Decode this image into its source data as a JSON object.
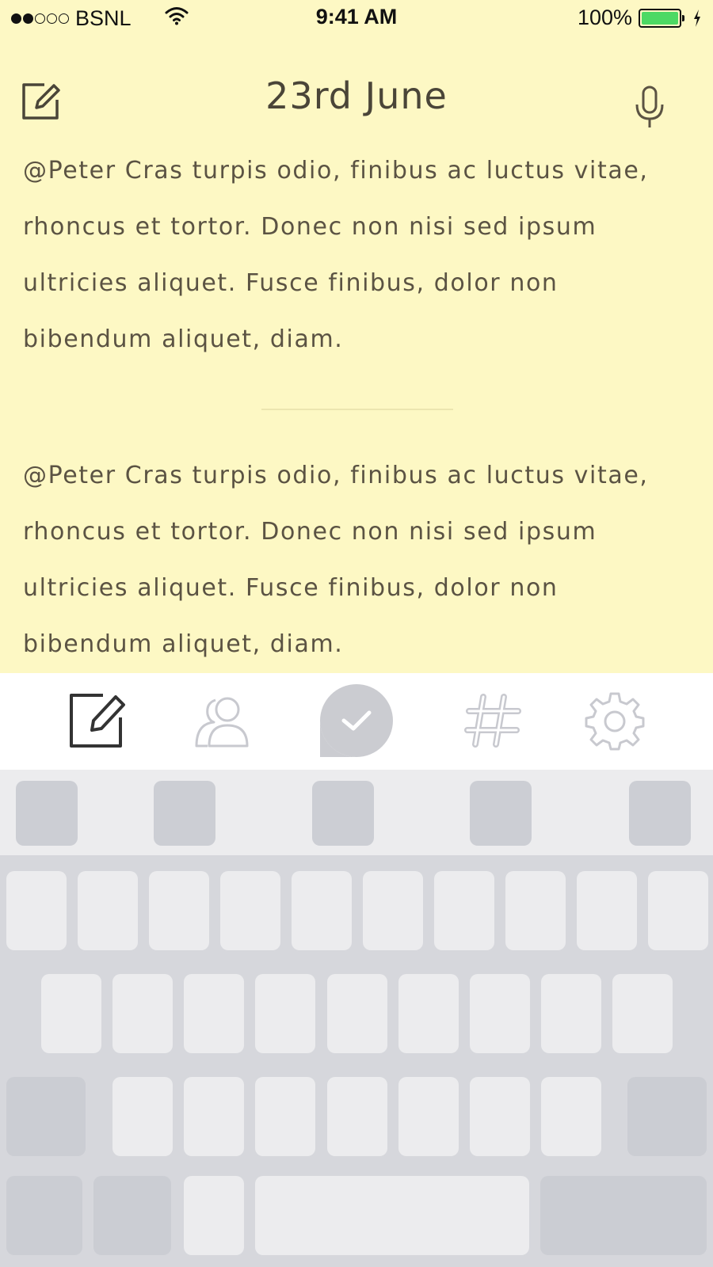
{
  "status_bar": {
    "carrier": "BSNL",
    "signal_filled": 2,
    "signal_total": 5,
    "time": "9:41 AM",
    "battery_percent": "100%",
    "battery_level": 1.0,
    "battery_color": "#4cd964"
  },
  "header": {
    "title": "23rd June",
    "left_icon": "compose-icon",
    "right_icon": "microphone-icon"
  },
  "notes": [
    {
      "text": "@Peter Cras turpis odio, finibus ac luctus vitae, rhoncus et tortor. Donec non nisi sed ipsum ultricies aliquet. Fusce finibus, dolor non bibendum aliquet, diam."
    },
    {
      "text": "@Peter Cras turpis odio, finibus ac luctus vitae, rhoncus et tortor. Donec non nisi sed ipsum ultricies aliquet. Fusce finibus, dolor non bibendum aliquet, diam."
    }
  ],
  "tabbar": {
    "tabs": [
      {
        "icon": "compose-icon",
        "active": true
      },
      {
        "icon": "contacts-icon",
        "active": false
      },
      {
        "icon": "checkmark-icon",
        "active": false
      },
      {
        "icon": "hashtag-icon",
        "active": false
      },
      {
        "icon": "settings-gear-icon",
        "active": false
      }
    ]
  },
  "colors": {
    "note_background": "#fdf8c4",
    "text": "#5b5343",
    "icon_inactive": "#c8c9cf",
    "icon_active": "#333333"
  }
}
